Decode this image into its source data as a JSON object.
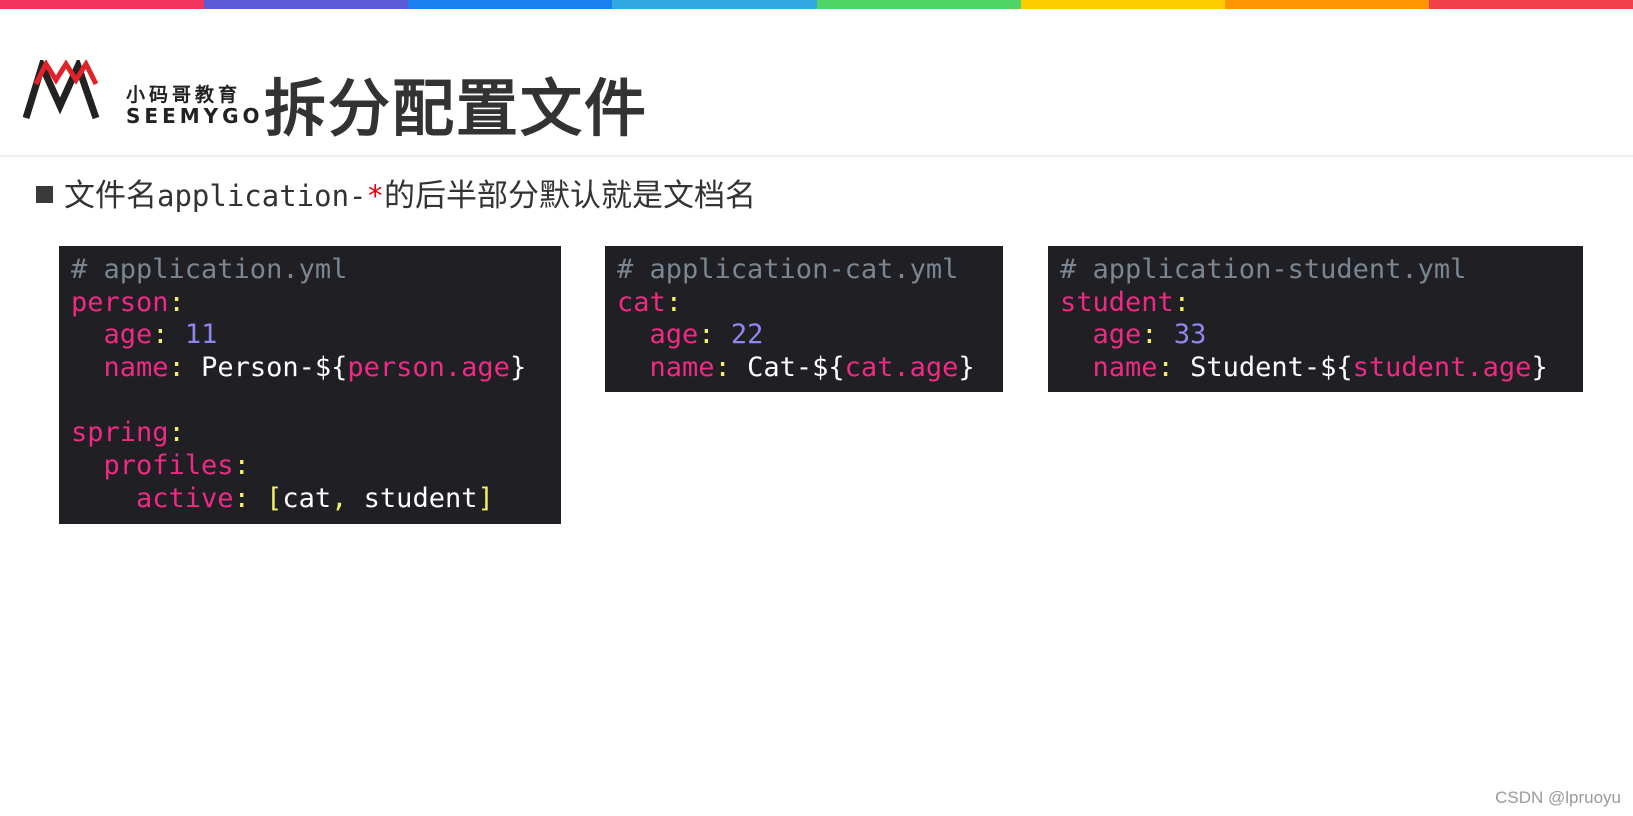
{
  "stripe_colors": [
    "#f2345f",
    "#5b5bd6",
    "#1a7ff0",
    "#32a8e0",
    "#4fd466",
    "#ffcc00",
    "#ff9500",
    "#f2404a"
  ],
  "logo": {
    "cn": "小码哥教育",
    "en": "SEEMYGO",
    "mark_color": "#e0232b"
  },
  "title": "拆分配置文件",
  "bullet": {
    "prefix": "文件名",
    "code": "application-",
    "star": "*",
    "suffix": "的后半部分默认就是文档名"
  },
  "code_blocks": [
    {
      "comment": "# application.yml",
      "lines": [
        {
          "indent": "",
          "key": "person",
          "value": ""
        },
        {
          "indent": "  ",
          "key": "age",
          "value": "11"
        },
        {
          "indent": "  ",
          "key": "name",
          "prefix": "Person-${",
          "var": "person.age",
          "suffix": "}"
        },
        {
          "indent": "",
          "key": "",
          "value": ""
        },
        {
          "indent": "",
          "key": "spring",
          "value": ""
        },
        {
          "indent": "  ",
          "key": "profiles",
          "value": ""
        },
        {
          "indent": "    ",
          "key": "active",
          "list": [
            "cat",
            "student"
          ]
        }
      ]
    },
    {
      "comment": "# application-cat.yml",
      "lines": [
        {
          "indent": "",
          "key": "cat",
          "value": ""
        },
        {
          "indent": "  ",
          "key": "age",
          "value": "22"
        },
        {
          "indent": "  ",
          "key": "name",
          "prefix": "Cat-${",
          "var": "cat.age",
          "suffix": "}"
        }
      ]
    },
    {
      "comment": "# application-student.yml",
      "lines": [
        {
          "indent": "",
          "key": "student",
          "value": ""
        },
        {
          "indent": "  ",
          "key": "age",
          "value": "33"
        },
        {
          "indent": "  ",
          "key": "name",
          "prefix": "Student-${",
          "var": "student.age",
          "suffix": "}"
        }
      ]
    }
  ],
  "watermark": "CSDN @lpruoyu"
}
